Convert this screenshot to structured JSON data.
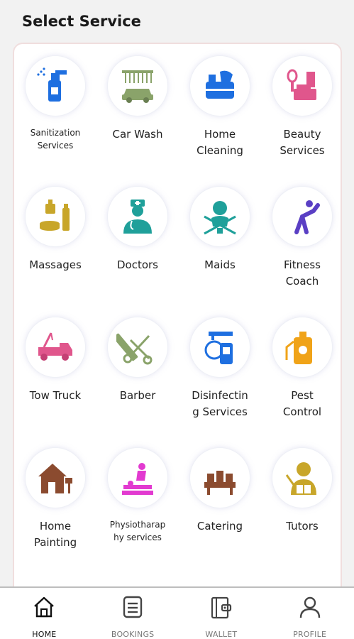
{
  "header": {
    "title": "Select Service"
  },
  "services": [
    {
      "label": "Sanitization\nServices",
      "icon": "sanitizer-spray-icon"
    },
    {
      "label": "Car Wash",
      "icon": "car-wash-icon"
    },
    {
      "label": "Home\nCleaning",
      "icon": "cleaning-supplies-icon"
    },
    {
      "label": "Beauty\nServices",
      "icon": "beauty-products-icon"
    },
    {
      "label": "Massages",
      "icon": "massage-oils-icon"
    },
    {
      "label": "Doctors",
      "icon": "doctor-icon"
    },
    {
      "label": "Maids",
      "icon": "maid-icon"
    },
    {
      "label": "Fitness\nCoach",
      "icon": "fitness-icon"
    },
    {
      "label": "Tow Truck",
      "icon": "tow-truck-icon"
    },
    {
      "label": "Barber",
      "icon": "barber-icon"
    },
    {
      "label": "Disinfectin\ng Services",
      "icon": "disinfecting-machine-icon"
    },
    {
      "label": "Pest\nControl",
      "icon": "pest-sprayer-icon"
    },
    {
      "label": "Home\nPainting",
      "icon": "house-painting-icon"
    },
    {
      "label": "Physiotharap\nhy services",
      "icon": "physiotherapy-icon"
    },
    {
      "label": "Catering",
      "icon": "catering-icon"
    },
    {
      "label": "Tutors",
      "icon": "tutor-icon"
    }
  ],
  "nav": [
    {
      "label": "HOME",
      "icon": "home-icon"
    },
    {
      "label": "BOOKINGS",
      "icon": "bookings-icon"
    },
    {
      "label": "WALLET",
      "icon": "wallet-icon"
    },
    {
      "label": "PROFILE",
      "icon": "profile-icon"
    }
  ],
  "colors": {
    "blue": "#1e6fe0",
    "green": "#8aa36a",
    "pink": "#e0568c",
    "gold": "#c8a62a",
    "teal": "#1fa09a",
    "purple": "#5a3fc4",
    "orange": "#f0a318",
    "brown": "#8b4b2f",
    "magenta": "#e23ad0"
  }
}
